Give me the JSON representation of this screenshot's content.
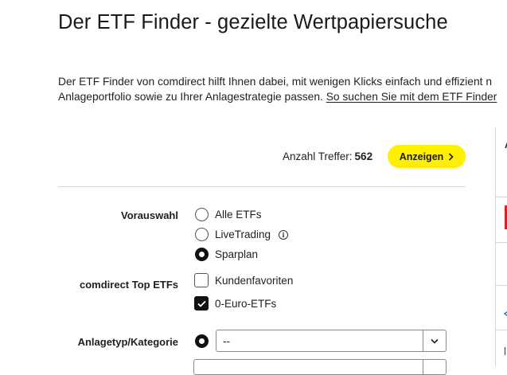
{
  "header": {
    "title": "Der ETF Finder - gezielte Wertpapiersuche"
  },
  "intro": {
    "line1": "Der ETF Finder von comdirect hilft Ihnen dabei, mit wenigen Klicks einfach und effizient n",
    "line2_text": "Anlageportfolio sowie zu Ihrer Anlagestrategie passen. ",
    "line2_link": "So suchen Sie mit dem ETF Finder"
  },
  "results": {
    "label": "Anzahl Treffer:",
    "count": "562",
    "button_label": "Anzeigen",
    "button_icon": "chevron-right-icon"
  },
  "filters": {
    "vorauswahl": {
      "label": "Vorauswahl",
      "options": [
        {
          "label": "Alle ETFs",
          "selected": false
        },
        {
          "label": "LiveTrading",
          "selected": false,
          "icon": "info-icon"
        },
        {
          "label": "Sparplan",
          "selected": true
        }
      ]
    },
    "top_etfs": {
      "label": "comdirect Top ETFs",
      "options": [
        {
          "label": "Kundenfavoriten",
          "checked": false
        },
        {
          "label": "0-Euro-ETFs",
          "checked": true
        }
      ]
    },
    "anlagetyp": {
      "label": "Anlagetyp/Kategorie",
      "selected": true,
      "value": "--"
    }
  },
  "side_panel": {
    "letter": "A",
    "colors": {
      "marker": "#d72323",
      "link": "#2b6cb0"
    }
  },
  "colors": {
    "accent": "#fff000",
    "text": "#1f1f1f",
    "divider": "#d9d9d9"
  }
}
